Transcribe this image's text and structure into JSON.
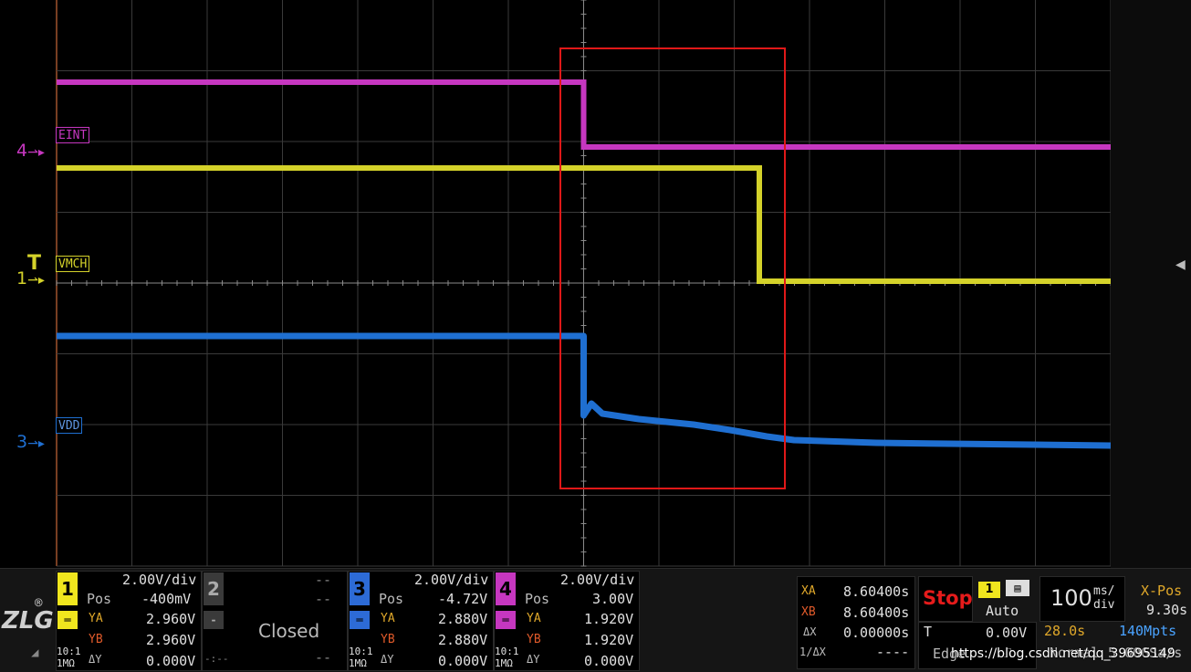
{
  "channels_labels": {
    "eint": "EINT",
    "vmch": "VMCH",
    "vdd": "VDD",
    "marker4": "4",
    "marker1": "1",
    "marker3": "3",
    "trigger": "T"
  },
  "colors": {
    "ch1": "#d4d22a",
    "ch3": "#1f6fd1",
    "ch4": "#c637c0",
    "highlight_box": "#e01818",
    "stop": "#e51b1b"
  },
  "brand": {
    "logo": "ZLG",
    "registered": "®"
  },
  "ch1": {
    "num": "1",
    "scale": "2.00V/div",
    "pos_label": "Pos",
    "pos": "-400mV",
    "ya_label": "YA",
    "ya": "2.960V",
    "yb_label": "YB",
    "yb": "2.960V",
    "dy_label": "ΔY",
    "dy": "0.000V",
    "probe": "10:1",
    "imp": "1MΩ"
  },
  "ch2": {
    "num": "2",
    "dash1": "--",
    "dash2": "--",
    "minus": "-",
    "status": "Closed",
    "dash3": "-:--",
    "dash4": "--"
  },
  "ch3": {
    "num": "3",
    "scale": "2.00V/div",
    "pos_label": "Pos",
    "pos": "-4.72V",
    "ya_label": "YA",
    "ya": "2.880V",
    "yb_label": "YB",
    "yb": "2.880V",
    "dy_label": "ΔY",
    "dy": "0.000V",
    "probe": "10:1",
    "imp": "1MΩ"
  },
  "ch4": {
    "num": "4",
    "scale": "2.00V/div",
    "pos_label": "Pos",
    "pos": "3.00V",
    "ya_label": "YA",
    "ya": "1.920V",
    "yb_label": "YB",
    "yb": "1.920V",
    "dy_label": "ΔY",
    "dy": "0.000V",
    "probe": "10:1",
    "imp": "1MΩ"
  },
  "cursor": {
    "xa_label": "XA",
    "xa": "8.60400s",
    "xb_label": "XB",
    "xb": "8.60400s",
    "dx_label": "ΔX",
    "dx": "0.00000s",
    "inv_label": "1/ΔX",
    "inv": "----"
  },
  "run": {
    "state": "Stop"
  },
  "trigger": {
    "source": "1",
    "mode": "Auto",
    "t_label": "T",
    "level": "0.00V",
    "type": "Edge"
  },
  "timebase": {
    "value": "100",
    "unit_top": "ms/",
    "unit_bottom": "div",
    "xpos_label": "X-Pos",
    "xpos": "9.30s",
    "duration": "28.0s",
    "memory": "140Mpts",
    "acq": "Normal",
    "extra": "5.00GSa/s"
  },
  "watermark": "https://blog.csdn.net/qq_39695149"
}
